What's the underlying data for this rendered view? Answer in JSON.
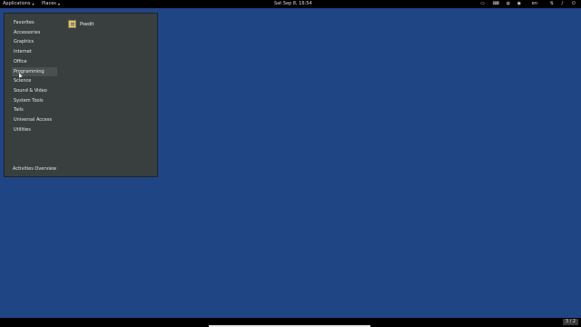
{
  "topbar": {
    "applications_label": "Applications",
    "places_label": "Places",
    "clock": "Sat Sep  8, 16:54",
    "input_method": "en"
  },
  "apps_menu": {
    "categories": [
      {
        "label": "Favorites"
      },
      {
        "label": "Accessories"
      },
      {
        "label": "Graphics"
      },
      {
        "label": "Internet"
      },
      {
        "label": "Office"
      },
      {
        "label": "Programming"
      },
      {
        "label": "Science"
      },
      {
        "label": "Sound & Video"
      },
      {
        "label": "System Tools"
      },
      {
        "label": "Tails"
      },
      {
        "label": "Universal Access"
      },
      {
        "label": "Utilities"
      }
    ],
    "selected_category": "Programming",
    "apps": [
      {
        "label": "Poedit",
        "icon": "poedit-icon"
      }
    ],
    "activities_overview": "Activities Overview"
  },
  "workspace_indicator": "3 / 2",
  "colors": {
    "desktop": "#1f4585",
    "panel": "#393f3f",
    "topbar": "#000000"
  }
}
